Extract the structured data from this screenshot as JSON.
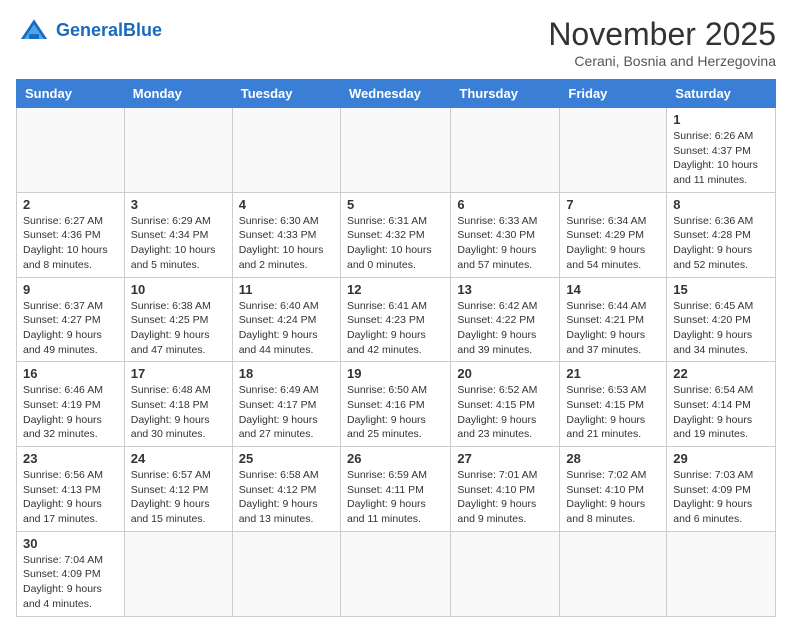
{
  "logo": {
    "text_general": "General",
    "text_blue": "Blue"
  },
  "header": {
    "month": "November 2025",
    "location": "Cerani, Bosnia and Herzegovina"
  },
  "weekdays": [
    "Sunday",
    "Monday",
    "Tuesday",
    "Wednesday",
    "Thursday",
    "Friday",
    "Saturday"
  ],
  "weeks": [
    [
      {
        "day": "",
        "info": ""
      },
      {
        "day": "",
        "info": ""
      },
      {
        "day": "",
        "info": ""
      },
      {
        "day": "",
        "info": ""
      },
      {
        "day": "",
        "info": ""
      },
      {
        "day": "",
        "info": ""
      },
      {
        "day": "1",
        "info": "Sunrise: 6:26 AM\nSunset: 4:37 PM\nDaylight: 10 hours\nand 11 minutes."
      }
    ],
    [
      {
        "day": "2",
        "info": "Sunrise: 6:27 AM\nSunset: 4:36 PM\nDaylight: 10 hours\nand 8 minutes."
      },
      {
        "day": "3",
        "info": "Sunrise: 6:29 AM\nSunset: 4:34 PM\nDaylight: 10 hours\nand 5 minutes."
      },
      {
        "day": "4",
        "info": "Sunrise: 6:30 AM\nSunset: 4:33 PM\nDaylight: 10 hours\nand 2 minutes."
      },
      {
        "day": "5",
        "info": "Sunrise: 6:31 AM\nSunset: 4:32 PM\nDaylight: 10 hours\nand 0 minutes."
      },
      {
        "day": "6",
        "info": "Sunrise: 6:33 AM\nSunset: 4:30 PM\nDaylight: 9 hours\nand 57 minutes."
      },
      {
        "day": "7",
        "info": "Sunrise: 6:34 AM\nSunset: 4:29 PM\nDaylight: 9 hours\nand 54 minutes."
      },
      {
        "day": "8",
        "info": "Sunrise: 6:36 AM\nSunset: 4:28 PM\nDaylight: 9 hours\nand 52 minutes."
      }
    ],
    [
      {
        "day": "9",
        "info": "Sunrise: 6:37 AM\nSunset: 4:27 PM\nDaylight: 9 hours\nand 49 minutes."
      },
      {
        "day": "10",
        "info": "Sunrise: 6:38 AM\nSunset: 4:25 PM\nDaylight: 9 hours\nand 47 minutes."
      },
      {
        "day": "11",
        "info": "Sunrise: 6:40 AM\nSunset: 4:24 PM\nDaylight: 9 hours\nand 44 minutes."
      },
      {
        "day": "12",
        "info": "Sunrise: 6:41 AM\nSunset: 4:23 PM\nDaylight: 9 hours\nand 42 minutes."
      },
      {
        "day": "13",
        "info": "Sunrise: 6:42 AM\nSunset: 4:22 PM\nDaylight: 9 hours\nand 39 minutes."
      },
      {
        "day": "14",
        "info": "Sunrise: 6:44 AM\nSunset: 4:21 PM\nDaylight: 9 hours\nand 37 minutes."
      },
      {
        "day": "15",
        "info": "Sunrise: 6:45 AM\nSunset: 4:20 PM\nDaylight: 9 hours\nand 34 minutes."
      }
    ],
    [
      {
        "day": "16",
        "info": "Sunrise: 6:46 AM\nSunset: 4:19 PM\nDaylight: 9 hours\nand 32 minutes."
      },
      {
        "day": "17",
        "info": "Sunrise: 6:48 AM\nSunset: 4:18 PM\nDaylight: 9 hours\nand 30 minutes."
      },
      {
        "day": "18",
        "info": "Sunrise: 6:49 AM\nSunset: 4:17 PM\nDaylight: 9 hours\nand 27 minutes."
      },
      {
        "day": "19",
        "info": "Sunrise: 6:50 AM\nSunset: 4:16 PM\nDaylight: 9 hours\nand 25 minutes."
      },
      {
        "day": "20",
        "info": "Sunrise: 6:52 AM\nSunset: 4:15 PM\nDaylight: 9 hours\nand 23 minutes."
      },
      {
        "day": "21",
        "info": "Sunrise: 6:53 AM\nSunset: 4:15 PM\nDaylight: 9 hours\nand 21 minutes."
      },
      {
        "day": "22",
        "info": "Sunrise: 6:54 AM\nSunset: 4:14 PM\nDaylight: 9 hours\nand 19 minutes."
      }
    ],
    [
      {
        "day": "23",
        "info": "Sunrise: 6:56 AM\nSunset: 4:13 PM\nDaylight: 9 hours\nand 17 minutes."
      },
      {
        "day": "24",
        "info": "Sunrise: 6:57 AM\nSunset: 4:12 PM\nDaylight: 9 hours\nand 15 minutes."
      },
      {
        "day": "25",
        "info": "Sunrise: 6:58 AM\nSunset: 4:12 PM\nDaylight: 9 hours\nand 13 minutes."
      },
      {
        "day": "26",
        "info": "Sunrise: 6:59 AM\nSunset: 4:11 PM\nDaylight: 9 hours\nand 11 minutes."
      },
      {
        "day": "27",
        "info": "Sunrise: 7:01 AM\nSunset: 4:10 PM\nDaylight: 9 hours\nand 9 minutes."
      },
      {
        "day": "28",
        "info": "Sunrise: 7:02 AM\nSunset: 4:10 PM\nDaylight: 9 hours\nand 8 minutes."
      },
      {
        "day": "29",
        "info": "Sunrise: 7:03 AM\nSunset: 4:09 PM\nDaylight: 9 hours\nand 6 minutes."
      }
    ],
    [
      {
        "day": "30",
        "info": "Sunrise: 7:04 AM\nSunset: 4:09 PM\nDaylight: 9 hours\nand 4 minutes."
      },
      {
        "day": "",
        "info": ""
      },
      {
        "day": "",
        "info": ""
      },
      {
        "day": "",
        "info": ""
      },
      {
        "day": "",
        "info": ""
      },
      {
        "day": "",
        "info": ""
      },
      {
        "day": "",
        "info": ""
      }
    ]
  ]
}
